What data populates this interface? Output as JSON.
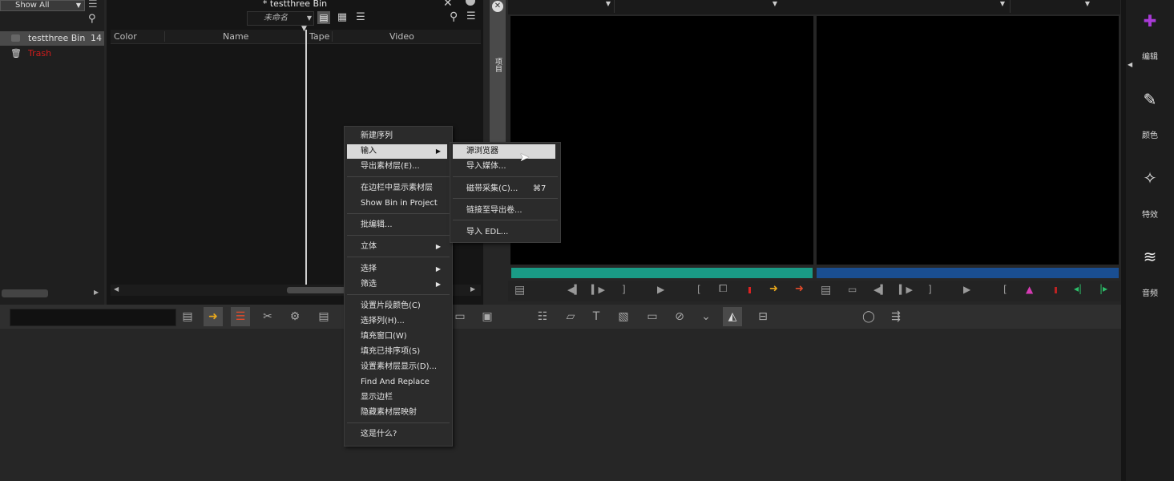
{
  "left_panel": {
    "filter_label": "Show All",
    "items": [
      {
        "label": "testthree Bin",
        "extra": "14"
      },
      {
        "label": "Trash"
      }
    ]
  },
  "bin": {
    "title": "* testthree Bin",
    "view_select": "未命名",
    "columns": [
      "Color",
      "Name",
      "Tape",
      "Video"
    ]
  },
  "vertical_tab_label": "项目",
  "sidebar": {
    "items": [
      {
        "label": "编辑",
        "icon": "edit-icon"
      },
      {
        "label": "颜色",
        "icon": "eyedropper-icon"
      },
      {
        "label": "特效",
        "icon": "magic-wand-icon"
      },
      {
        "label": "音频",
        "icon": "waveform-icon"
      }
    ]
  },
  "context_menu": {
    "items": [
      "新建序列",
      "输入",
      "导出素材层(E)...",
      "在边栏中显示素材层",
      "Show Bin in Project",
      "批编辑...",
      "立体",
      "选择",
      "筛选",
      "设置片段颜色(C)",
      "选择列(H)...",
      "填充窗口(W)",
      "填充已排序项(S)",
      "设置素材层显示(D)...",
      "Find And Replace",
      "显示边栏",
      "隐藏素材层映射",
      "这是什么?"
    ]
  },
  "submenu": {
    "items": [
      "源浏览器",
      "导入媒体...",
      "磁带采集(C)...",
      "链接至导出卷...",
      "导入 EDL..."
    ],
    "shortcut": "⌘7"
  },
  "colors": {
    "accent_teal": "#1a9b86",
    "accent_blue": "#1a4e91",
    "sidebar_accent": "#a83ad6",
    "trash_red": "#d01c1c"
  }
}
